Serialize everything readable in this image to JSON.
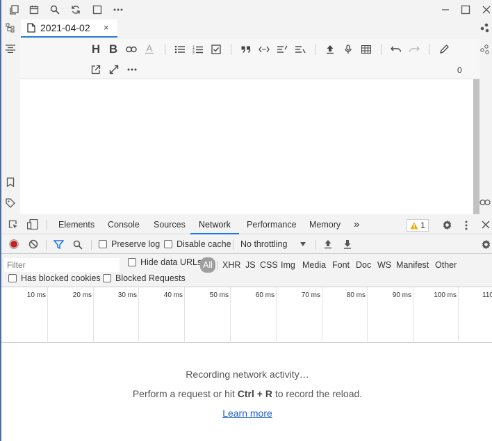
{
  "editor": {
    "tab_title": "2021-04-02",
    "tab_close": "×",
    "word_count": "0"
  },
  "devtools": {
    "tabs": [
      "Elements",
      "Console",
      "Sources",
      "Network",
      "Performance",
      "Memory"
    ],
    "active_tab": "Network",
    "more_tabs": "»",
    "warning_count": "1",
    "network": {
      "preserve_log": "Preserve log",
      "disable_cache": "Disable cache",
      "throttling": "No throttling",
      "filter_placeholder": "Filter",
      "hide_data_urls": "Hide data URLs",
      "types": [
        "All",
        "XHR",
        "JS",
        "CSS",
        "Img",
        "Media",
        "Font",
        "Doc",
        "WS",
        "Manifest",
        "Other"
      ],
      "has_blocked_cookies": "Has blocked cookies",
      "blocked_requests": "Blocked Requests",
      "timeline_ticks": [
        "10 ms",
        "20 ms",
        "30 ms",
        "40 ms",
        "50 ms",
        "60 ms",
        "70 ms",
        "80 ms",
        "90 ms",
        "100 ms",
        "110"
      ],
      "empty": {
        "line1": "Recording network activity…",
        "line2_pre": "Perform a request or hit ",
        "line2_shortcut": "Ctrl + R",
        "line2_post": " to record the reload.",
        "link": "Learn more"
      }
    }
  },
  "colors": {
    "accent": "#1a73e8",
    "record": "#c5221f",
    "filter_icon": "#1a73e8",
    "warning": "#f2a600"
  }
}
